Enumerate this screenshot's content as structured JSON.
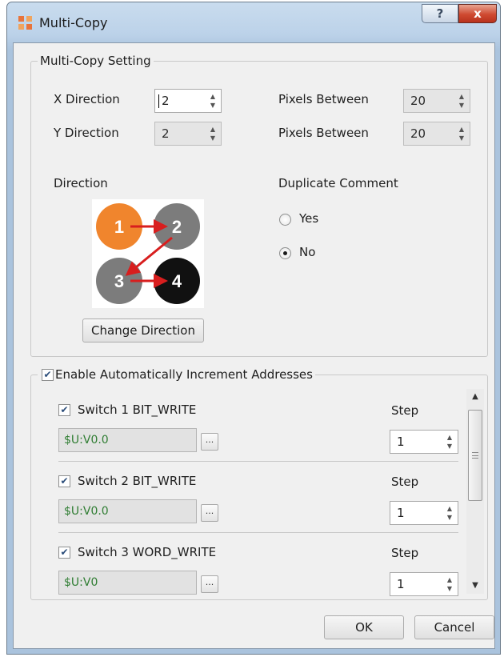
{
  "window": {
    "title": "Multi-Copy",
    "help_label": "?",
    "close_label": "x"
  },
  "multi_copy_setting": {
    "legend": "Multi-Copy Setting",
    "x_direction": {
      "label": "X Direction",
      "value": "2"
    },
    "y_direction": {
      "label": "Y Direction",
      "value": "2"
    },
    "x_pixels_between": {
      "label": "Pixels Between",
      "value": "20"
    },
    "y_pixels_between": {
      "label": "Pixels Between",
      "value": "20"
    },
    "direction_label": "Direction",
    "direction_image": {
      "circles": [
        "1",
        "2",
        "3",
        "4"
      ],
      "colors": {
        "one": "#f0852d",
        "two": "#7c7c7c",
        "three": "#7c7c7c",
        "four": "#111111",
        "arrow": "#d81e1e"
      }
    },
    "change_direction_label": "Change Direction",
    "duplicate_comment": {
      "label": "Duplicate Comment",
      "options": [
        "Yes",
        "No"
      ],
      "selected": "No"
    }
  },
  "auto_increment": {
    "legend": "Enable Automatically Increment Addresses",
    "enabled": true,
    "items": [
      {
        "label": "Switch 1 BIT_WRITE",
        "checked": true,
        "address": "$U:V0.0",
        "step_label": "Step",
        "step": "1"
      },
      {
        "label": "Switch 2 BIT_WRITE",
        "checked": true,
        "address": "$U:V0.0",
        "step_label": "Step",
        "step": "1"
      },
      {
        "label": "Switch 3 WORD_WRITE",
        "checked": true,
        "address": "$U:V0",
        "step_label": "Step",
        "step": "1"
      }
    ],
    "ellipsis_label": "...",
    "scrollbar_icons": {
      "up": "triangle-up",
      "down": "triangle-down"
    }
  },
  "footer": {
    "ok_label": "OK",
    "cancel_label": "Cancel"
  }
}
